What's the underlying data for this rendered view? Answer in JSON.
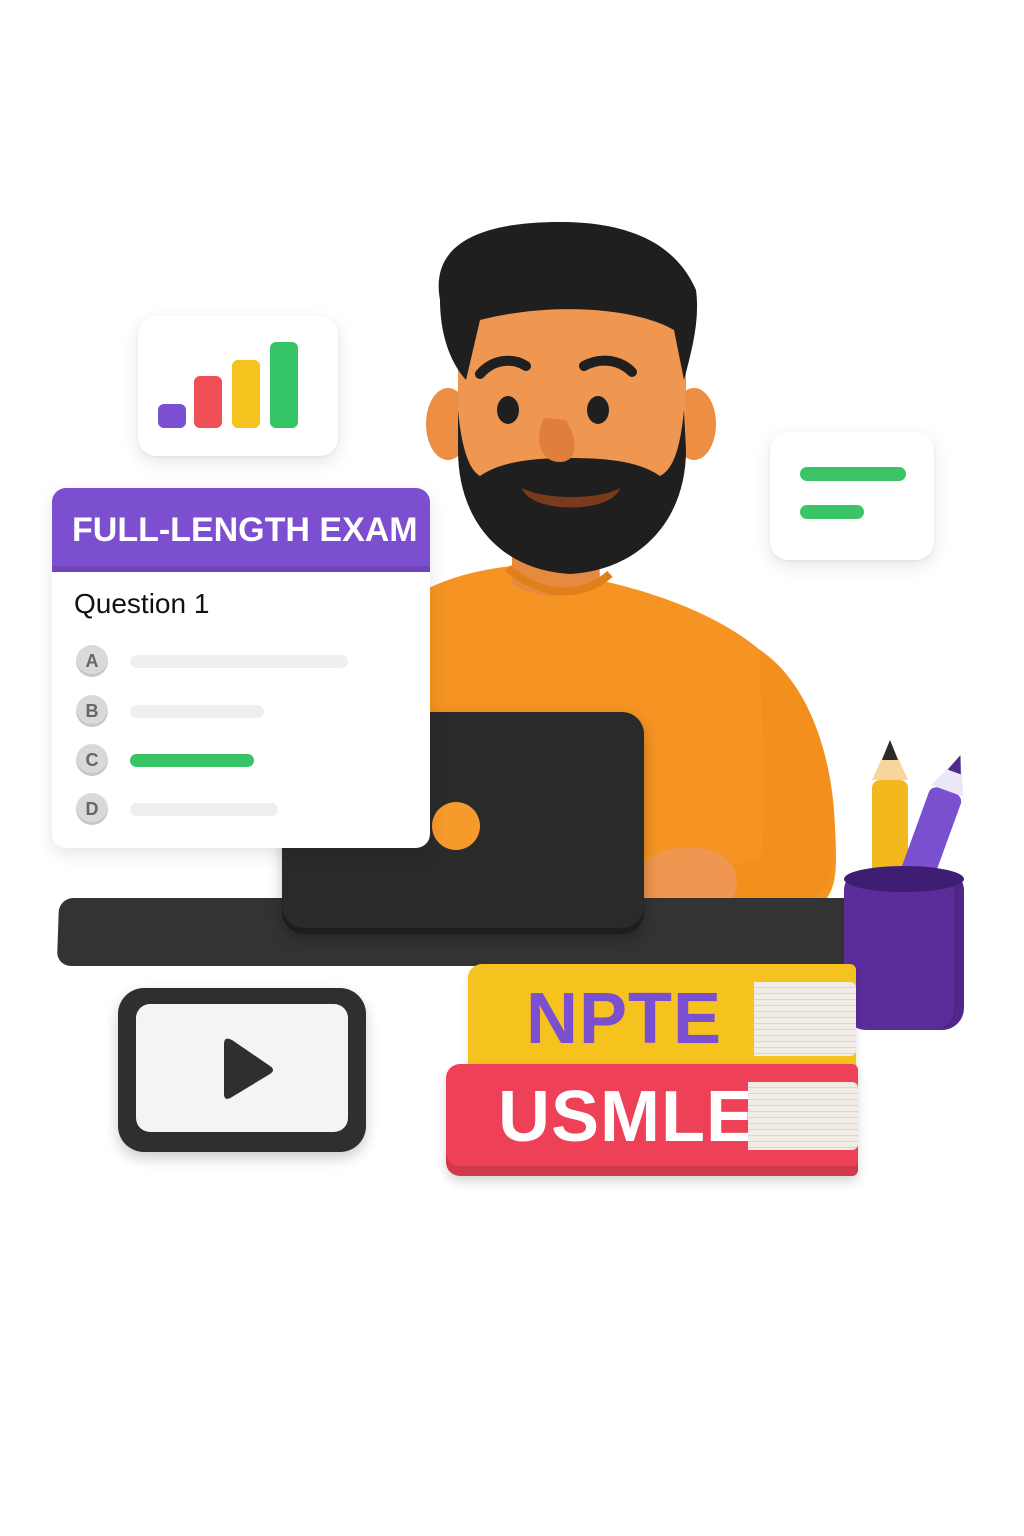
{
  "exam_panel": {
    "header": "FULL-LENGTH EXAM",
    "question": "Question 1",
    "options": [
      {
        "letter": "A",
        "selected": false
      },
      {
        "letter": "B",
        "selected": false
      },
      {
        "letter": "C",
        "selected": true
      },
      {
        "letter": "D",
        "selected": false
      }
    ]
  },
  "books": {
    "top": "NPTE",
    "bottom": "USMLE"
  },
  "colors": {
    "purple": "#7b4fd0",
    "orange": "#f59a2b",
    "green": "#38c464",
    "yellow": "#f6c21d",
    "red": "#ee4157",
    "dark": "#2f2f2f"
  },
  "icons": [
    "bar-chart-icon",
    "text-lines-icon",
    "play-icon",
    "pencil-icon"
  ]
}
